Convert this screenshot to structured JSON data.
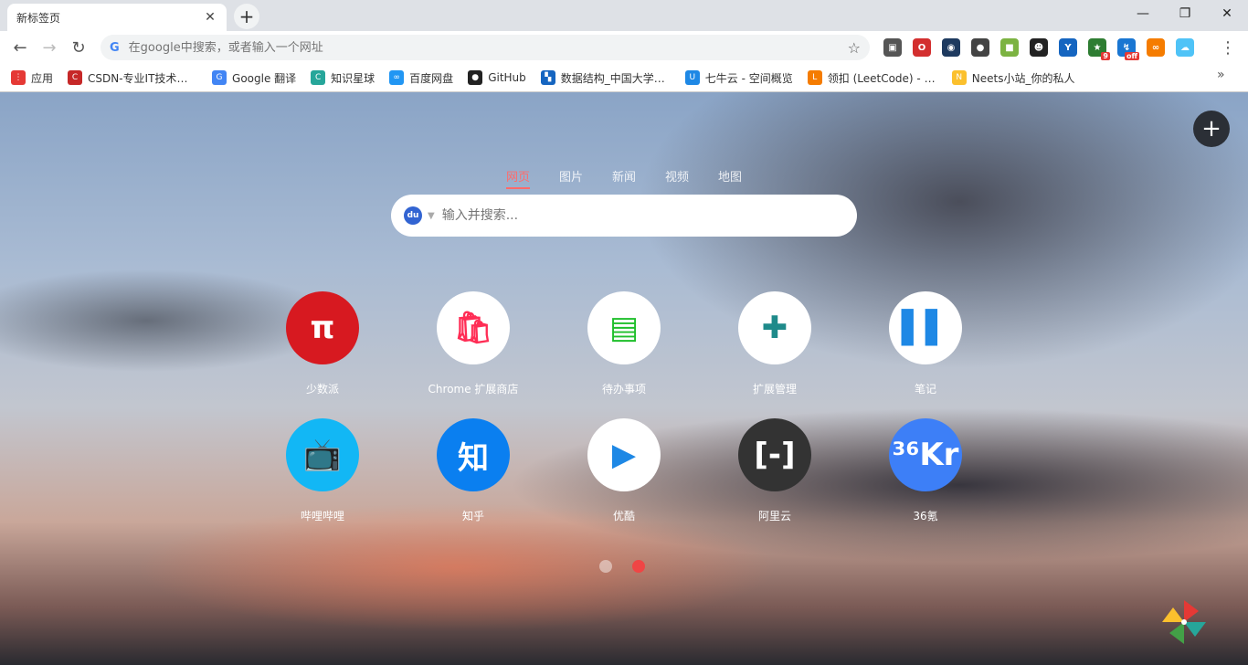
{
  "tab": {
    "title": "新标签页",
    "close": "✕"
  },
  "newtab": "+",
  "window": {
    "minimize": "—",
    "restore": "❐",
    "close": "✕"
  },
  "toolbar": {
    "back": "←",
    "forward": "→",
    "reload": "↻",
    "omnibox_placeholder": "在google中搜索，或者输入一个网址",
    "star": "☆",
    "menu": "⋮"
  },
  "extensions": [
    {
      "name": "ext-1",
      "color": "#555555",
      "glyph": "▣"
    },
    {
      "name": "ext-2",
      "color": "#d32f2f",
      "glyph": "O"
    },
    {
      "name": "ext-3",
      "color": "#1e3a5f",
      "glyph": "◉"
    },
    {
      "name": "ext-4",
      "color": "#444444",
      "glyph": "●"
    },
    {
      "name": "ext-5",
      "color": "#7cb342",
      "glyph": "■"
    },
    {
      "name": "ext-6",
      "color": "#222222",
      "glyph": "☻"
    },
    {
      "name": "ext-7",
      "color": "#1565c0",
      "glyph": "Y"
    },
    {
      "name": "ext-8",
      "color": "#2e7d32",
      "glyph": "★",
      "badge": "9"
    },
    {
      "name": "ext-9",
      "color": "#1976d2",
      "glyph": "↯",
      "badge": "off"
    },
    {
      "name": "ext-10",
      "color": "#f57c00",
      "glyph": "∞"
    },
    {
      "name": "ext-11",
      "color": "#4fc3f7",
      "glyph": "☁"
    }
  ],
  "bookmarks": [
    {
      "label": "应用",
      "color": "#e53935",
      "glyph": "⋮"
    },
    {
      "label": "CSDN-专业IT技术社区",
      "color": "#c62828",
      "glyph": "C"
    },
    {
      "label": "Google 翻译",
      "color": "#4285f4",
      "glyph": "G"
    },
    {
      "label": "知识星球",
      "color": "#26a69a",
      "glyph": "C"
    },
    {
      "label": "百度网盘",
      "color": "#2196f3",
      "glyph": "∞"
    },
    {
      "label": "GitHub",
      "color": "#222222",
      "glyph": "●"
    },
    {
      "label": "数据结构_中国大学MOOC",
      "color": "#1565c0",
      "glyph": "▚"
    },
    {
      "label": "七牛云 - 空间概览",
      "color": "#1e88e5",
      "glyph": "U"
    },
    {
      "label": "领扣 (LeetCode) - 极客",
      "color": "#f57c00",
      "glyph": "L"
    },
    {
      "label": "Neets小站_你的私人",
      "color": "#fbc02d",
      "glyph": "N"
    }
  ],
  "bookmarks_more": "»",
  "search": {
    "tabs": [
      "网页",
      "图片",
      "新闻",
      "视频",
      "地图"
    ],
    "engine_glyph": "du",
    "caret": "▼",
    "placeholder": "输入并搜索..."
  },
  "add_button": "+",
  "tiles": [
    {
      "name": "少数派",
      "color": "#d71920",
      "glyph": "π",
      "glyph_color": "#ffffff"
    },
    {
      "name": "Chrome 扩展商店",
      "color": "#ffffff",
      "glyph": "🛍",
      "glyph_color": "#ff2d55"
    },
    {
      "name": "待办事项",
      "color": "#ffffff",
      "glyph": "▤",
      "glyph_color": "#1fbf2b"
    },
    {
      "name": "扩展管理",
      "color": "#ffffff",
      "glyph": "✚",
      "glyph_color": "#1e8a8a"
    },
    {
      "name": "笔记",
      "color": "#ffffff",
      "glyph": "▌▌",
      "glyph_color": "#1e88e5"
    },
    {
      "name": "哔哩哔哩",
      "color": "#12b7f5",
      "glyph": "📺",
      "glyph_color": "#ffffff"
    },
    {
      "name": "知乎",
      "color": "#0a7ff0",
      "glyph": "知",
      "glyph_color": "#ffffff"
    },
    {
      "name": "优酷",
      "color": "#ffffff",
      "glyph": "▶",
      "glyph_color": "#1e88e5"
    },
    {
      "name": "阿里云",
      "color": "#333333",
      "glyph": "[-]",
      "glyph_color": "#ffffff"
    },
    {
      "name": "36氪",
      "color": "#3d7ff7",
      "glyph": "³⁶Kr",
      "glyph_color": "#ffffff"
    }
  ],
  "pagination": {
    "pages": 2,
    "current": 2
  }
}
